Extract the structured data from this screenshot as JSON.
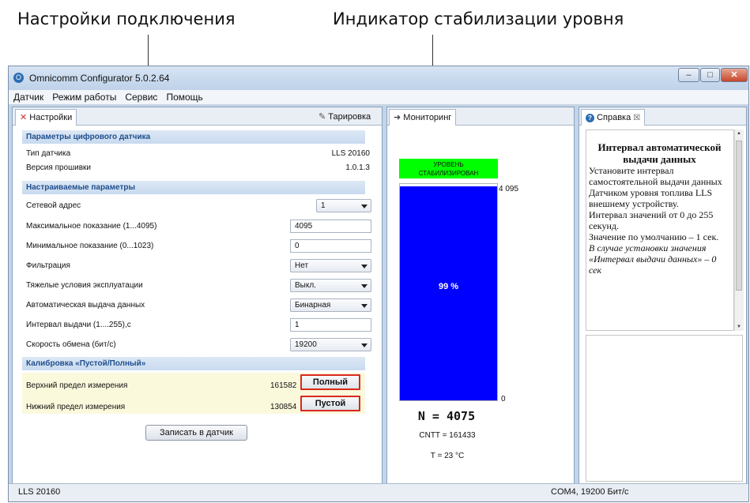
{
  "callouts": {
    "left": "Настройки подключения",
    "right": "Индикатор стабилизации уровня"
  },
  "window": {
    "title": "Omnicomm Configurator 5.0.2.64",
    "controls": {
      "minimize": "–",
      "maximize": "□",
      "close": "✕"
    }
  },
  "menu": [
    "Датчик",
    "Режим работы",
    "Сервис",
    "Помощь"
  ],
  "tabs": {
    "settings": "Настройки",
    "calibration": "Тарировка",
    "monitoring": "Мониторинг",
    "help": "Справка",
    "help_close": "☒"
  },
  "settings": {
    "section_digital": "Параметры цифрового датчика",
    "sensor_type_label": "Тип датчика",
    "sensor_type_value": "LLS 20160",
    "firmware_label": "Версия прошивки",
    "firmware_value": "1.0.1.3",
    "section_params": "Настраиваемые параметры",
    "network_address_label": "Сетевой адрес",
    "network_address_value": "1",
    "max_label": "Максимальное показание  (1...4095)",
    "max_value": "4095",
    "min_label": "Минимальное показание (0...1023)",
    "min_value": "0",
    "filter_label": "Фильтрация",
    "filter_value": "Нет",
    "heavy_label": "Тяжелые условия эксплуатации",
    "heavy_value": "Выкл.",
    "auto_label": "Автоматическая выдача данных",
    "auto_value": "Бинарная",
    "interval_label": "Интервал выдачи (1....255),с",
    "interval_value": "1",
    "speed_label": "Скорость обмена (бит/с)",
    "speed_value": "19200",
    "section_calib": "Калибровка «Пустой/Полный»",
    "upper_label": "Верхний предел измерения",
    "upper_value": "161582",
    "full_button": "Полный",
    "lower_label": "Нижний предел измерения",
    "lower_value": "130854",
    "empty_button": "Пустой",
    "write_button": "Записать в датчик"
  },
  "monitoring": {
    "status_line1": "УРОВЕНЬ",
    "status_line2": "СТАБИЛИЗИРОВАН",
    "status_color": "#00ff00",
    "scale_max": "4 095",
    "scale_min": "0",
    "fill_percent": 99,
    "percent_label": "99 %",
    "fill_color": "#0000ff",
    "n_value": "N = 4075",
    "cntt_value": "CNTT = 161433",
    "temp_value": "T =  23 °C"
  },
  "help": {
    "title": "Интервал автоматической выдачи данных",
    "p1": "Установите интервал самостоятельной выдачи данных Датчиком уровня топлива LLS внешнему устройству.",
    "p2": "Интервал значений от 0 до 255 секунд.",
    "p3": "Значение по умолчанию – 1 сек.",
    "p4": "В случае установки значения «Интервал выдачи данных» – 0 сек"
  },
  "status": {
    "left": "LLS 20160",
    "right": "COM4, 19200 Бит/с"
  }
}
